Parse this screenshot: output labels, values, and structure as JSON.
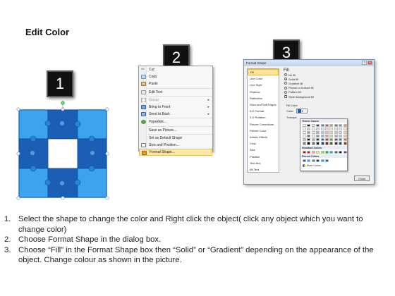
{
  "title": "Edit Color",
  "badges": [
    "1",
    "2",
    "3"
  ],
  "colors": {
    "puzzle_light": "#3ba3f0",
    "puzzle_dark": "#1a5fb5",
    "puzzle_center": "#ffffff",
    "highlight": "#fbe7a1"
  },
  "context_menu": {
    "items": [
      {
        "label": "Cut",
        "underline": "t",
        "icon": "scissors-icon",
        "disabled": false
      },
      {
        "label": "Copy",
        "icon": "copy-icon",
        "disabled": false
      },
      {
        "label": "Paste",
        "icon": "paste-icon",
        "disabled": false
      },
      {
        "label": "Edit Text",
        "icon": "edit-text-icon",
        "disabled": false
      },
      {
        "label": "Group",
        "icon": "group-icon",
        "disabled": true,
        "submenu": true
      },
      {
        "label": "Bring to Front",
        "icon": "bring-front-icon",
        "disabled": false,
        "submenu": true
      },
      {
        "label": "Send to Back",
        "icon": "send-back-icon",
        "disabled": false,
        "submenu": true
      },
      {
        "label": "Hyperlink...",
        "icon": "hyperlink-icon",
        "disabled": false
      },
      {
        "label": "Save as Picture...",
        "icon": "",
        "disabled": false
      },
      {
        "label": "Set as Default Shape",
        "icon": "",
        "disabled": false
      },
      {
        "label": "Size and Position...",
        "icon": "size-position-icon",
        "disabled": false
      },
      {
        "label": "Format Shape...",
        "icon": "format-shape-icon",
        "disabled": false,
        "highlighted": true
      }
    ]
  },
  "dialog": {
    "title": "Format Shape",
    "nav": [
      "Fill",
      "Line Color",
      "Line Style",
      "Shadow",
      "Reflection",
      "Glow and Soft Edges",
      "3-D Format",
      "3-D Rotation",
      "Picture Corrections",
      "Picture Color",
      "Artistic Effects",
      "Crop",
      "Size",
      "Position",
      "Text Box",
      "Alt Text"
    ],
    "selected_nav": "Fill",
    "panel_heading": "Fill",
    "fill_options": [
      {
        "label": "No fill",
        "selected": false
      },
      {
        "label": "Solid fill",
        "selected": true
      },
      {
        "label": "Gradient fill",
        "selected": false
      },
      {
        "label": "Picture or texture fill",
        "selected": false
      },
      {
        "label": "Pattern fill",
        "selected": false
      },
      {
        "label": "Slide background fill",
        "selected": false
      }
    ],
    "fill_color_label": "Fill Color",
    "color_label": "Color:",
    "transparency_label": "Transpa",
    "close_button": "Close"
  },
  "palette": {
    "theme_heading": "Theme Colors",
    "standard_heading": "Standard Colors",
    "recent_heading": "Recent Colors",
    "more_colors": "More Colors...",
    "theme_top": [
      "#ffffff",
      "#000000",
      "#eeece1",
      "#1f497d",
      "#4f81bd",
      "#c0504d",
      "#9bbb59",
      "#8064a2",
      "#4bacc6",
      "#f79646"
    ],
    "standard": [
      "#c00000",
      "#ff0000",
      "#ffc000",
      "#ffff00",
      "#92d050",
      "#00b050",
      "#00b0f0",
      "#0070c0",
      "#002060",
      "#7030a0"
    ],
    "recent": [
      "#1a5fb5",
      "#3ba3f0",
      "#4f81bd",
      "#17375e",
      "#00b0f0",
      "#0070c0"
    ]
  },
  "instructions": [
    {
      "num": "1.",
      "text": "Select the shape to change the color and Right click the object( click any object which you want to change color)"
    },
    {
      "num": "2.",
      "text": "Choose Format Shape in the dialog box."
    },
    {
      "num": "3.",
      "text": "Choose “Fill” in the Format Shape box then “Solid” or “Gradient” depending on the appearance of the object. Change colour as shown in the picture."
    }
  ]
}
